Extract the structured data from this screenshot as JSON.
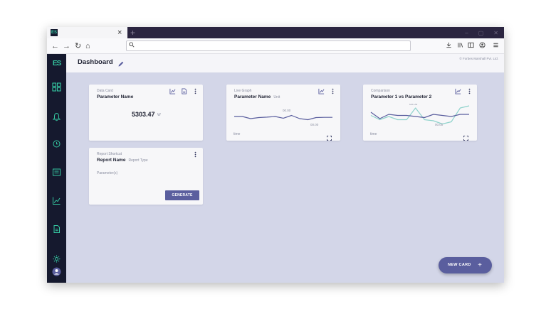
{
  "browser": {
    "tab_favicon": "ES",
    "tab_close": "×",
    "new_tab": "+",
    "window_controls": [
      "–",
      "▢",
      "✕"
    ],
    "nav": {
      "back": "←",
      "forward": "→",
      "reload": "↻",
      "home": "⌂"
    },
    "url": {
      "search_icon": "search-icon",
      "value": ""
    }
  },
  "sidebar": {
    "logo": "ES",
    "items": [
      {
        "name": "dashboard-icon",
        "active": true
      },
      {
        "name": "bell-icon"
      },
      {
        "name": "history-icon"
      },
      {
        "name": "report-icon"
      },
      {
        "name": "chart-icon"
      },
      {
        "name": "document-icon"
      },
      {
        "name": "settings-icon"
      },
      {
        "name": "user-icon"
      }
    ]
  },
  "header": {
    "title": "Dashboard",
    "copyright": "© Forbes Marshall Pvt. Ltd."
  },
  "colors": {
    "accent": "#5a5e9e",
    "sidebar_bg": "#15192e",
    "brand_green": "#35c7a1",
    "series_primary": "#5a5e9e",
    "series_secondary": "#8fd3cc"
  },
  "cards": {
    "data_card": {
      "label": "Data Card",
      "title": "Parameter Name",
      "value": "5303.47",
      "unit": "W"
    },
    "live_graph": {
      "label": "Live Graph",
      "title": "Parameter Name",
      "unit": "Unit",
      "time_label": "time",
      "annotations": [
        "00.00",
        "00.00"
      ]
    },
    "comparison": {
      "label": "Comparison",
      "title": "Parameter 1 vs Parameter 2",
      "time_label": "time",
      "annotations": [
        "00.00",
        "00.00"
      ]
    },
    "report_shortcut": {
      "label": "Report Shortcut",
      "title": "Report Name",
      "type": "Report Type",
      "parameters": "Parameter(s)",
      "button": "GENERATE"
    }
  },
  "fab": {
    "label": "NEW CARD",
    "icon": "+"
  },
  "chart_data": [
    {
      "type": "line",
      "series": [
        {
          "values": [
            50,
            50,
            40,
            45,
            47,
            50,
            42,
            55,
            40,
            35,
            45,
            46,
            46
          ]
        }
      ],
      "ylim": [
        0,
        100
      ],
      "annotations": [
        "00.00",
        "00.00"
      ]
    },
    {
      "type": "line",
      "series": [
        {
          "values": [
            70,
            40,
            60,
            55,
            55,
            50,
            45,
            60,
            55,
            50,
            60,
            60
          ]
        },
        {
          "values": [
            55,
            35,
            50,
            35,
            35,
            90,
            35,
            30,
            15,
            25,
            90,
            100
          ]
        }
      ],
      "ylim": [
        0,
        100
      ],
      "annotations": [
        "00.00",
        "00.00"
      ]
    }
  ]
}
